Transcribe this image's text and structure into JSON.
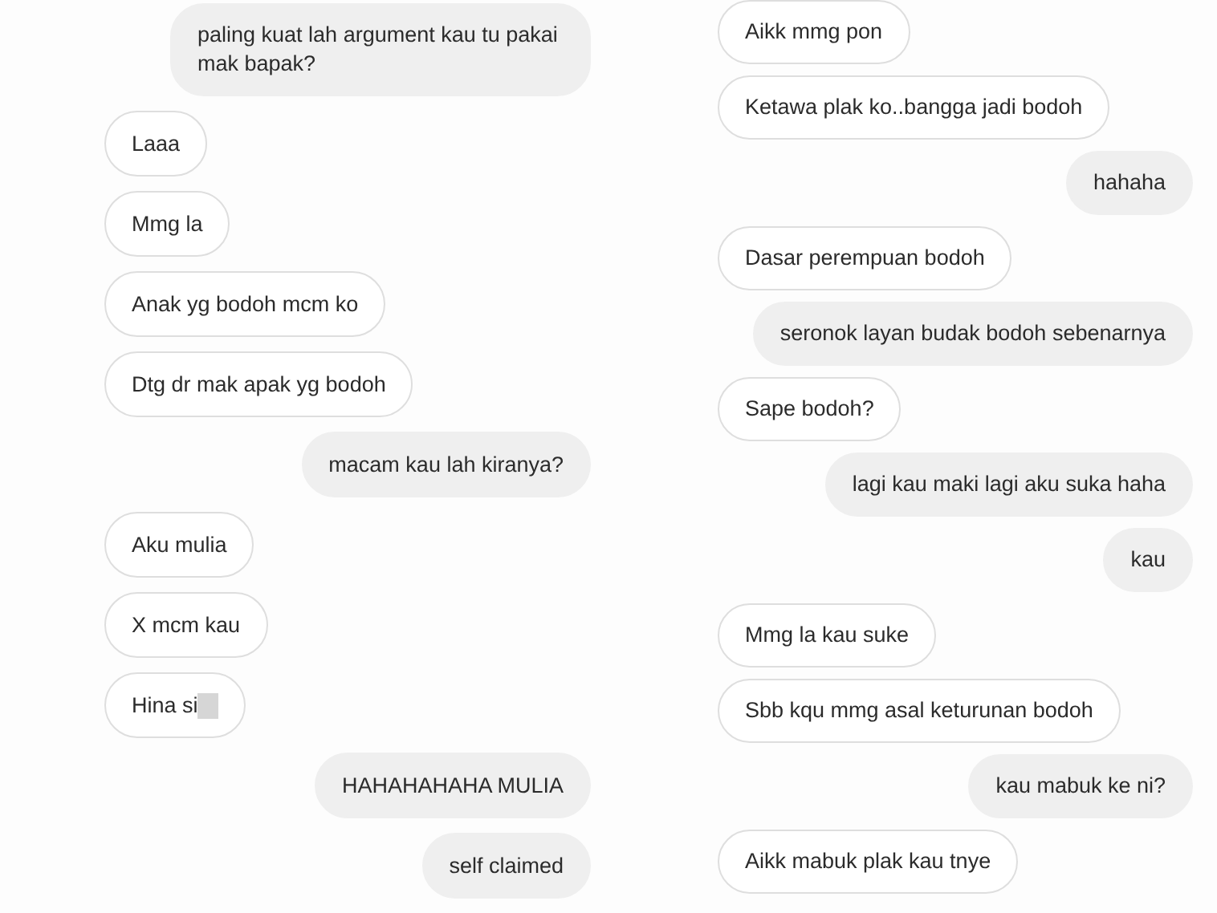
{
  "panels": [
    {
      "messages": [
        {
          "kind": "sent",
          "text": "paling kuat lah argument kau tu pakai mak bapak?",
          "redacted": false
        },
        {
          "kind": "received",
          "text": "Laaa",
          "redacted": false
        },
        {
          "kind": "received",
          "text": "Mmg la",
          "redacted": false
        },
        {
          "kind": "received",
          "text": "Anak yg bodoh mcm ko",
          "redacted": false
        },
        {
          "kind": "received",
          "text": "Dtg dr mak apak yg bodoh",
          "redacted": false
        },
        {
          "kind": "sent",
          "text": "macam kau lah kiranya?",
          "redacted": false
        },
        {
          "kind": "received",
          "text": "Aku mulia",
          "redacted": false
        },
        {
          "kind": "received",
          "text": "X mcm kau",
          "redacted": false
        },
        {
          "kind": "received",
          "text": "Hina si",
          "redacted": true
        },
        {
          "kind": "sent",
          "text": "HAHAHAHAHA MULIA",
          "redacted": false
        },
        {
          "kind": "sent",
          "text": "self claimed",
          "redacted": false
        }
      ]
    },
    {
      "messages": [
        {
          "kind": "received",
          "text": "Aikk mmg pon",
          "redacted": false
        },
        {
          "kind": "received",
          "text": "Ketawa plak ko..bangga jadi bodoh",
          "redacted": false
        },
        {
          "kind": "sent",
          "text": "hahaha",
          "redacted": false
        },
        {
          "kind": "received",
          "text": "Dasar perempuan bodoh",
          "redacted": false
        },
        {
          "kind": "sent",
          "text": "seronok layan budak bodoh sebenarnya",
          "redacted": false
        },
        {
          "kind": "received",
          "text": "Sape bodoh?",
          "redacted": false
        },
        {
          "kind": "sent",
          "text": "lagi kau maki lagi aku suka haha",
          "redacted": false
        },
        {
          "kind": "sent",
          "text": "kau",
          "redacted": false
        },
        {
          "kind": "received",
          "text": "Mmg la kau suke",
          "redacted": false
        },
        {
          "kind": "received",
          "text": "Sbb kqu mmg asal keturunan bodoh",
          "redacted": false
        },
        {
          "kind": "sent",
          "text": "kau mabuk ke ni?",
          "redacted": false
        },
        {
          "kind": "received",
          "text": "Aikk mabuk plak kau tnye",
          "redacted": false
        }
      ]
    }
  ]
}
